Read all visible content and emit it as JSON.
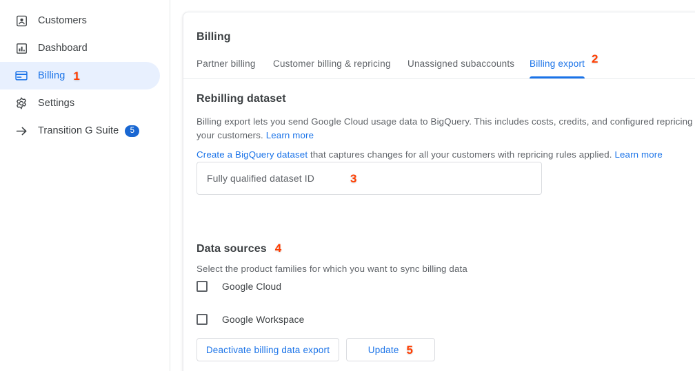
{
  "sidebar": {
    "items": [
      {
        "label": "Customers",
        "icon": "contact-card-icon",
        "active": false,
        "badge": null,
        "annotation": null
      },
      {
        "label": "Dashboard",
        "icon": "bar-chart-icon",
        "active": false,
        "badge": null,
        "annotation": null
      },
      {
        "label": "Billing",
        "icon": "credit-card-icon",
        "active": true,
        "badge": null,
        "annotation": "1"
      },
      {
        "label": "Settings",
        "icon": "gear-icon",
        "active": false,
        "badge": null,
        "annotation": null
      },
      {
        "label": "Transition G Suite",
        "icon": "arrow-right-icon",
        "active": false,
        "badge": "5",
        "annotation": null
      }
    ]
  },
  "card": {
    "title": "Billing",
    "tabs": [
      {
        "label": "Partner billing",
        "active": false,
        "annotation": null
      },
      {
        "label": "Customer billing & repricing",
        "active": false,
        "annotation": null
      },
      {
        "label": "Unassigned subaccounts",
        "active": false,
        "annotation": null
      },
      {
        "label": "Billing export",
        "active": true,
        "annotation": "2"
      }
    ],
    "rebilling": {
      "heading": "Rebilling dataset",
      "intro_text": "Billing export lets you send Google Cloud usage data to BigQuery. This includes costs, credits, and configured repricing for your customers. ",
      "intro_link": "Learn more",
      "create_link": "Create a BigQuery dataset",
      "create_text": " that captures changes for all your customers with repricing rules applied. ",
      "create_link2": "Learn more"
    },
    "dataset_field": {
      "value": "",
      "placeholder": "Fully qualified dataset ID",
      "annotation": "3"
    },
    "data_sources": {
      "heading": "Data sources",
      "annotation": "4",
      "subtitle": "Select the product families for which you want to sync billing data",
      "options": [
        {
          "label": "Google Cloud",
          "checked": false
        },
        {
          "label": "Google Workspace",
          "checked": false
        }
      ]
    },
    "actions": {
      "deactivate_label": "Deactivate billing data export",
      "update_label": "Update",
      "update_annotation": "5"
    }
  },
  "colors": {
    "accent_blue": "#1a73e8",
    "badge_blue": "#1967d2",
    "active_nav_bg": "#e8f0fe",
    "annotation_orange": "#ff3d00",
    "body_text": "#5f6368",
    "heading_text": "#3c4043",
    "border": "#dadce0"
  }
}
